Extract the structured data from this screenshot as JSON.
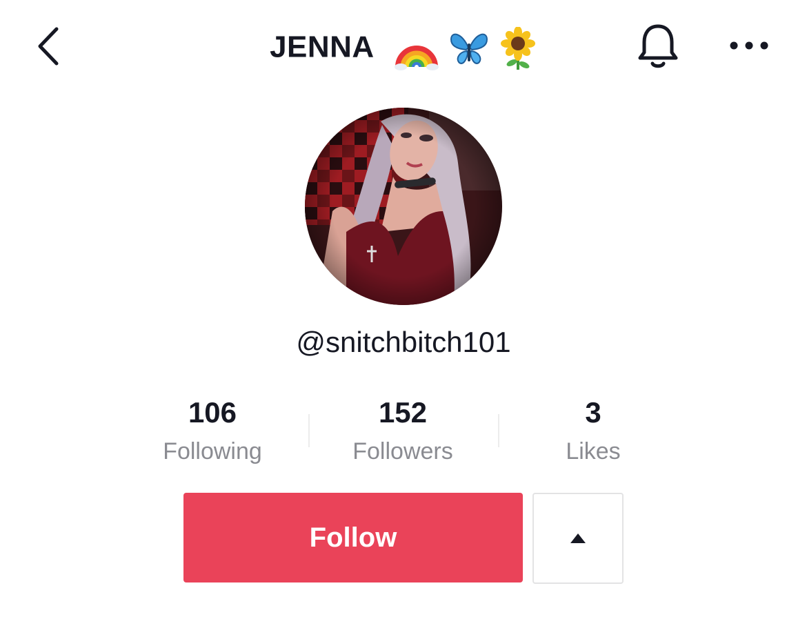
{
  "header": {
    "title": "JENNA",
    "title_emojis": [
      "rainbow-emoji",
      "butterfly-emoji",
      "sunflower-emoji"
    ],
    "back_icon": "chevron-left-icon",
    "bell_icon": "bell-icon",
    "more_icon": "more-horizontal-icon"
  },
  "profile": {
    "username": "@snitchbitch101"
  },
  "stats": [
    {
      "value": "106",
      "label": "Following"
    },
    {
      "value": "152",
      "label": "Followers"
    },
    {
      "value": "3",
      "label": "Likes"
    }
  ],
  "actions": {
    "follow_label": "Follow",
    "dropdown_icon": "triangle-up-icon"
  },
  "colors": {
    "follow_button": "#ea4359",
    "secondary_text": "#8a8b91",
    "primary_text": "#161823"
  }
}
